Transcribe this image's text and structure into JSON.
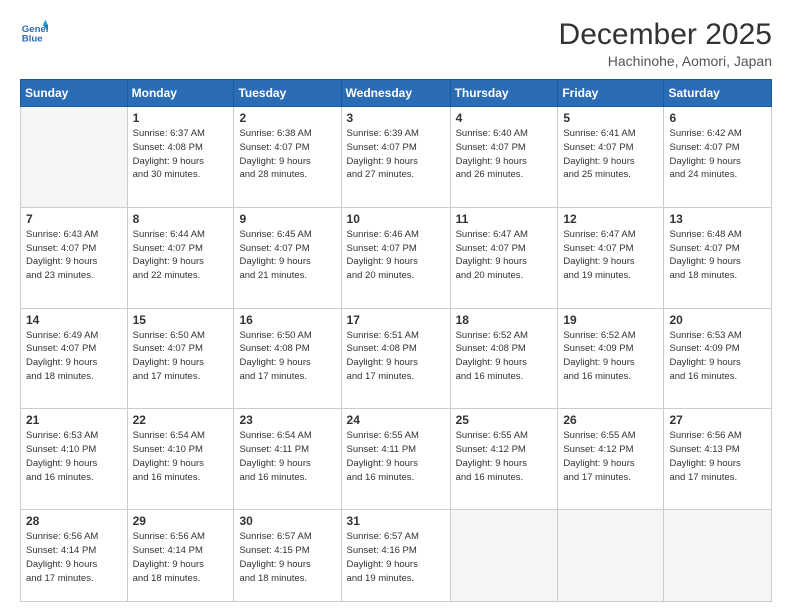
{
  "logo": {
    "line1": "General",
    "line2": "Blue"
  },
  "title": "December 2025",
  "location": "Hachinohe, Aomori, Japan",
  "days_of_week": [
    "Sunday",
    "Monday",
    "Tuesday",
    "Wednesday",
    "Thursday",
    "Friday",
    "Saturday"
  ],
  "weeks": [
    [
      {
        "num": "",
        "info": ""
      },
      {
        "num": "1",
        "info": "Sunrise: 6:37 AM\nSunset: 4:08 PM\nDaylight: 9 hours\nand 30 minutes."
      },
      {
        "num": "2",
        "info": "Sunrise: 6:38 AM\nSunset: 4:07 PM\nDaylight: 9 hours\nand 28 minutes."
      },
      {
        "num": "3",
        "info": "Sunrise: 6:39 AM\nSunset: 4:07 PM\nDaylight: 9 hours\nand 27 minutes."
      },
      {
        "num": "4",
        "info": "Sunrise: 6:40 AM\nSunset: 4:07 PM\nDaylight: 9 hours\nand 26 minutes."
      },
      {
        "num": "5",
        "info": "Sunrise: 6:41 AM\nSunset: 4:07 PM\nDaylight: 9 hours\nand 25 minutes."
      },
      {
        "num": "6",
        "info": "Sunrise: 6:42 AM\nSunset: 4:07 PM\nDaylight: 9 hours\nand 24 minutes."
      }
    ],
    [
      {
        "num": "7",
        "info": "Sunrise: 6:43 AM\nSunset: 4:07 PM\nDaylight: 9 hours\nand 23 minutes."
      },
      {
        "num": "8",
        "info": "Sunrise: 6:44 AM\nSunset: 4:07 PM\nDaylight: 9 hours\nand 22 minutes."
      },
      {
        "num": "9",
        "info": "Sunrise: 6:45 AM\nSunset: 4:07 PM\nDaylight: 9 hours\nand 21 minutes."
      },
      {
        "num": "10",
        "info": "Sunrise: 6:46 AM\nSunset: 4:07 PM\nDaylight: 9 hours\nand 20 minutes."
      },
      {
        "num": "11",
        "info": "Sunrise: 6:47 AM\nSunset: 4:07 PM\nDaylight: 9 hours\nand 20 minutes."
      },
      {
        "num": "12",
        "info": "Sunrise: 6:47 AM\nSunset: 4:07 PM\nDaylight: 9 hours\nand 19 minutes."
      },
      {
        "num": "13",
        "info": "Sunrise: 6:48 AM\nSunset: 4:07 PM\nDaylight: 9 hours\nand 18 minutes."
      }
    ],
    [
      {
        "num": "14",
        "info": "Sunrise: 6:49 AM\nSunset: 4:07 PM\nDaylight: 9 hours\nand 18 minutes."
      },
      {
        "num": "15",
        "info": "Sunrise: 6:50 AM\nSunset: 4:07 PM\nDaylight: 9 hours\nand 17 minutes."
      },
      {
        "num": "16",
        "info": "Sunrise: 6:50 AM\nSunset: 4:08 PM\nDaylight: 9 hours\nand 17 minutes."
      },
      {
        "num": "17",
        "info": "Sunrise: 6:51 AM\nSunset: 4:08 PM\nDaylight: 9 hours\nand 17 minutes."
      },
      {
        "num": "18",
        "info": "Sunrise: 6:52 AM\nSunset: 4:08 PM\nDaylight: 9 hours\nand 16 minutes."
      },
      {
        "num": "19",
        "info": "Sunrise: 6:52 AM\nSunset: 4:09 PM\nDaylight: 9 hours\nand 16 minutes."
      },
      {
        "num": "20",
        "info": "Sunrise: 6:53 AM\nSunset: 4:09 PM\nDaylight: 9 hours\nand 16 minutes."
      }
    ],
    [
      {
        "num": "21",
        "info": "Sunrise: 6:53 AM\nSunset: 4:10 PM\nDaylight: 9 hours\nand 16 minutes."
      },
      {
        "num": "22",
        "info": "Sunrise: 6:54 AM\nSunset: 4:10 PM\nDaylight: 9 hours\nand 16 minutes."
      },
      {
        "num": "23",
        "info": "Sunrise: 6:54 AM\nSunset: 4:11 PM\nDaylight: 9 hours\nand 16 minutes."
      },
      {
        "num": "24",
        "info": "Sunrise: 6:55 AM\nSunset: 4:11 PM\nDaylight: 9 hours\nand 16 minutes."
      },
      {
        "num": "25",
        "info": "Sunrise: 6:55 AM\nSunset: 4:12 PM\nDaylight: 9 hours\nand 16 minutes."
      },
      {
        "num": "26",
        "info": "Sunrise: 6:55 AM\nSunset: 4:12 PM\nDaylight: 9 hours\nand 17 minutes."
      },
      {
        "num": "27",
        "info": "Sunrise: 6:56 AM\nSunset: 4:13 PM\nDaylight: 9 hours\nand 17 minutes."
      }
    ],
    [
      {
        "num": "28",
        "info": "Sunrise: 6:56 AM\nSunset: 4:14 PM\nDaylight: 9 hours\nand 17 minutes."
      },
      {
        "num": "29",
        "info": "Sunrise: 6:56 AM\nSunset: 4:14 PM\nDaylight: 9 hours\nand 18 minutes."
      },
      {
        "num": "30",
        "info": "Sunrise: 6:57 AM\nSunset: 4:15 PM\nDaylight: 9 hours\nand 18 minutes."
      },
      {
        "num": "31",
        "info": "Sunrise: 6:57 AM\nSunset: 4:16 PM\nDaylight: 9 hours\nand 19 minutes."
      },
      {
        "num": "",
        "info": ""
      },
      {
        "num": "",
        "info": ""
      },
      {
        "num": "",
        "info": ""
      }
    ]
  ]
}
